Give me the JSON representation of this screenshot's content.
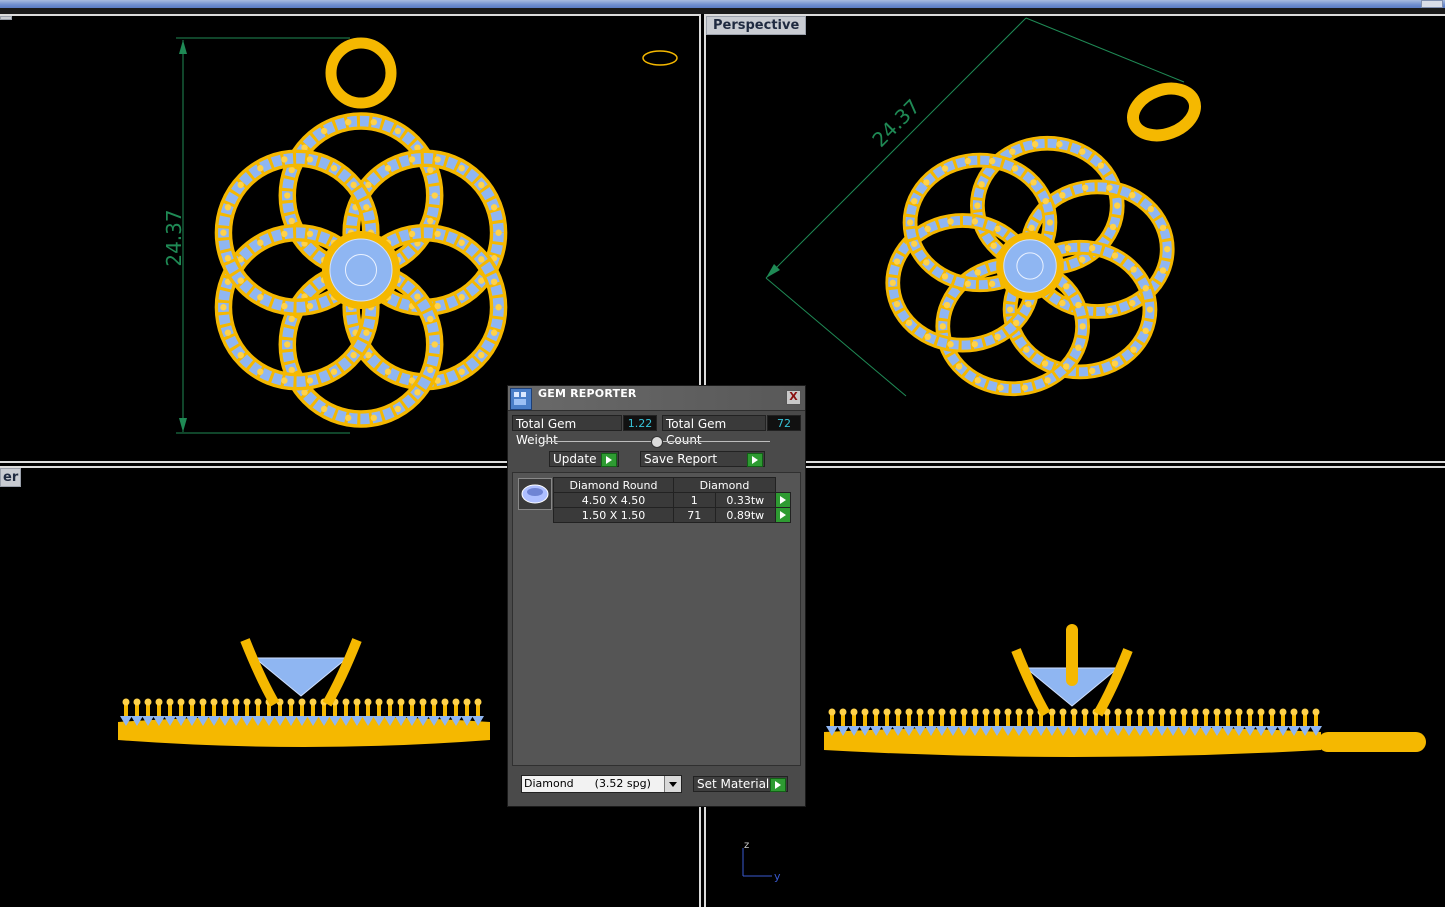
{
  "viewports": {
    "top_left": {
      "label": ""
    },
    "top_right": {
      "label": "Perspective"
    },
    "bottom_left": {
      "label": "er"
    },
    "bottom_right": {
      "label": ""
    }
  },
  "dimensions": {
    "front_height": "24.37",
    "perspective_height": "24.37"
  },
  "gem_reporter": {
    "title": "GEM REPORTER",
    "close": "X",
    "total_weight_label": "Total Gem Weight",
    "total_weight_value": "1.22",
    "total_count_label": "Total Gem Count",
    "total_count_value": "72",
    "update_label": "Update",
    "save_report_label": "Save Report",
    "table": {
      "headers": [
        "Diamond Round",
        "Diamond"
      ],
      "rows": [
        {
          "size": "4.50 X 4.50",
          "count": "1",
          "weight": "0.33tw"
        },
        {
          "size": "1.50 X 1.50",
          "count": "71",
          "weight": "0.89tw"
        }
      ]
    },
    "material_value": "Diamond      (3.52 spg)",
    "set_material_label": "Set Material"
  },
  "axis": {
    "z": "z",
    "y": "y"
  },
  "colors": {
    "gold": "#f5b800",
    "gem": "#8fb6f2",
    "dimension": "#1f8a55",
    "panel": "#4a4a4a"
  }
}
